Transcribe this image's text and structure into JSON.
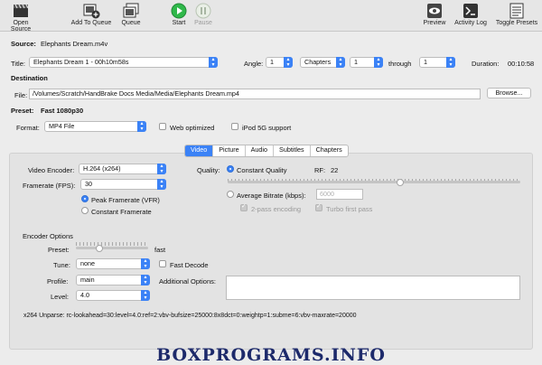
{
  "toolbar": {
    "open_source": "Open Source",
    "add_to_queue": "Add To Queue",
    "queue": "Queue",
    "start": "Start",
    "pause": "Pause",
    "preview": "Preview",
    "activity_log": "Activity Log",
    "toggle_presets": "Toggle Presets"
  },
  "source": {
    "label": "Source:",
    "value": "Elephants Dream.m4v"
  },
  "title_row": {
    "title_label": "Title:",
    "title_value": "Elephants Dream 1 - 00h10m58s",
    "angle_label": "Angle:",
    "angle_value": "1",
    "range_type": "Chapters",
    "from_value": "1",
    "through_label": "through",
    "to_value": "1",
    "duration_label": "Duration:",
    "duration_value": "00:10:58"
  },
  "destination": {
    "heading": "Destination",
    "file_label": "File:",
    "file_value": "/Volumes/Scratch/HandBrake Docs Media/Media/Elephants Dream.mp4",
    "browse": "Browse..."
  },
  "preset": {
    "label": "Preset:",
    "value": "Fast 1080p30"
  },
  "format": {
    "label": "Format:",
    "value": "MP4 File",
    "web_optimized": "Web optimized",
    "ipod_support": "iPod 5G support"
  },
  "tabs": [
    "Video",
    "Picture",
    "Audio",
    "Subtitles",
    "Chapters"
  ],
  "video": {
    "encoder_label": "Video Encoder:",
    "encoder_value": "H.264 (x264)",
    "framerate_label": "Framerate (FPS):",
    "framerate_value": "30",
    "peak": "Peak Framerate (VFR)",
    "constant": "Constant Framerate",
    "quality_label": "Quality:",
    "constant_quality": "Constant Quality",
    "rf_label": "RF:",
    "rf_value": "22",
    "avg_bitrate": "Average Bitrate (kbps):",
    "bitrate_placeholder": "6000",
    "two_pass": "2-pass encoding",
    "turbo": "Turbo first pass"
  },
  "encoder_options": {
    "heading": "Encoder Options",
    "preset_label": "Preset:",
    "preset_value": "fast",
    "tune_label": "Tune:",
    "tune_value": "none",
    "fast_decode": "Fast Decode",
    "profile_label": "Profile:",
    "profile_value": "main",
    "additional_label": "Additional Options:",
    "level_label": "Level:",
    "level_value": "4.0",
    "unparse": "x264 Unparse: rc-lookahead=30:level=4.0:ref=2:vbv-bufsize=25000:8x8dct=0:weightp=1:subme=6:vbv-maxrate=20000"
  },
  "watermark": "BOXPROGRAMS.INFO",
  "levels": {
    "quality_slider": 0.59,
    "preset_slider": 0.33
  },
  "colors": {
    "accent": "#3b82f6",
    "start_green": "#2fb84a",
    "watermark": "#1d2a6b"
  }
}
